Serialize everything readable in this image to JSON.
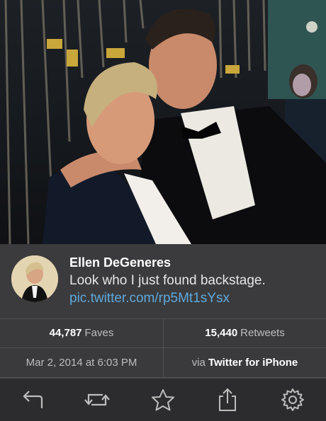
{
  "tweet": {
    "name": "Ellen DeGeneres",
    "text": "Look who I just found backstage.",
    "link": "pic.twitter.com/rp5Mt1sYsx"
  },
  "stats": {
    "faves_count": "44,787",
    "faves_label": "Faves",
    "retweets_count": "15,440",
    "retweets_label": "Retweets",
    "date": "Mar 2, 2014 at 6:03 PM",
    "via_prefix": "via",
    "via_app": "Twitter for iPhone"
  },
  "toolbar": {
    "icons": [
      "reply-icon",
      "retweet-icon",
      "favorite-icon",
      "share-icon",
      "settings-icon"
    ]
  },
  "colors": {
    "link": "#5ea9dd",
    "background": "#3a3a3c",
    "toolbar": "#2c2c2e"
  }
}
